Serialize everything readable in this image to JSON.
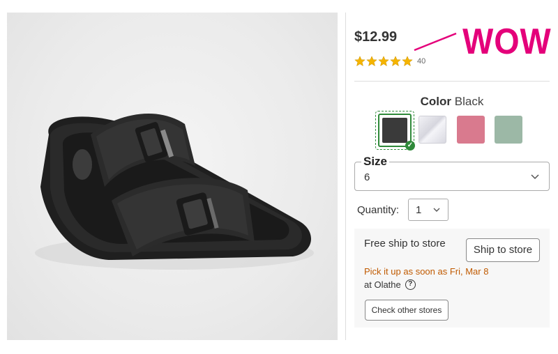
{
  "product": {
    "price": "$12.99",
    "rating_count": "40",
    "rating_value": 5,
    "rating_max": 5,
    "image_icon": "black-double-buckle-sandal-image"
  },
  "annotation": {
    "text": "WOW",
    "color": "#e4007a"
  },
  "color_picker": {
    "label": "Color",
    "selected": "Black",
    "swatches": [
      {
        "name": "Black",
        "hex": "#3a3a3a",
        "selected": true
      },
      {
        "name": "White",
        "hex": "#ececf2",
        "selected": false
      },
      {
        "name": "Pink",
        "hex": "#d97a8e",
        "selected": false
      },
      {
        "name": "Green",
        "hex": "#9cb8a6",
        "selected": false
      }
    ],
    "accent": "#2f8a3a"
  },
  "size": {
    "label": "Size",
    "value": "6"
  },
  "quantity": {
    "label": "Quantity:",
    "value": "1"
  },
  "shipping": {
    "title": "Free ship to store",
    "button": "Ship to store",
    "pickup": "Pick it up as soon as Fri, Mar 8",
    "store": "at Olathe",
    "help_icon": "?",
    "check_button": "Check other stores",
    "pickup_color": "#c05a00"
  }
}
